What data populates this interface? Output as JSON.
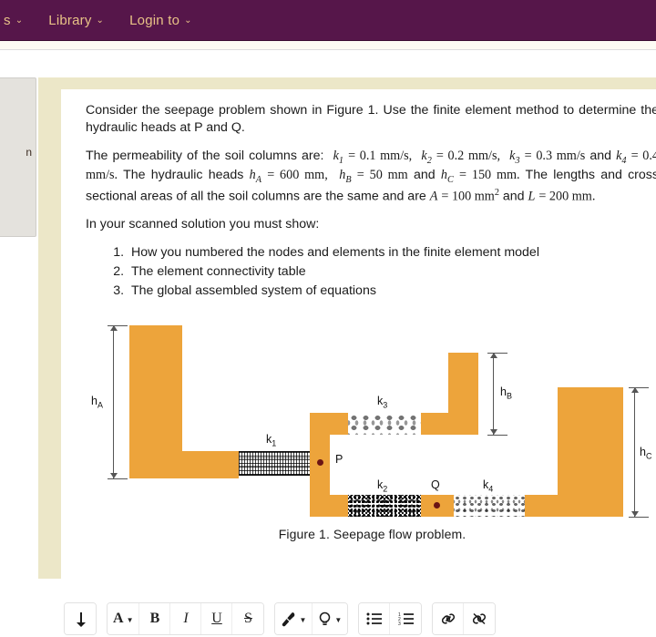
{
  "topnav": {
    "items": [
      {
        "label": "s",
        "caret": "⌄"
      },
      {
        "label": "Library",
        "caret": "⌄"
      },
      {
        "label": "Login to",
        "caret": "⌄"
      }
    ],
    "bg_color": "#56164a",
    "text_color": "#e8c287"
  },
  "left_panel": {
    "text": "n"
  },
  "question": {
    "para1": "Consider the seepage problem shown in Figure 1. Use the finite element method to determine the hydraulic heads at P and Q.",
    "para2_prefix": "The permeability of the soil columns are:",
    "k1": "k",
    "k1_sub": "1",
    "k1_val": "= 0.1 mm/s,",
    "k2": "k",
    "k2_sub": "2",
    "k2_val": "= 0.2 mm/s,",
    "k3": "k",
    "k3_sub": "3",
    "k3_val": "= 0.3 mm/s",
    "and1": "and",
    "k4": "k",
    "k4_sub": "4",
    "k4_val": "= 0.4 mm/s.",
    "heads_prefix": "The hydraulic heads",
    "hA": "h",
    "hA_sub": "A",
    "hA_val": "= 600 mm,",
    "hB": "h",
    "hB_sub": "B",
    "hB_val": "= 50 mm",
    "and2": "and",
    "hC": "h",
    "hC_sub": "C",
    "hC_val": "= 150 mm.",
    "tail": "The lengths and cross sectional areas of all the soil columns are the same and are",
    "A": "A",
    "A_val": "= 100 mm",
    "A_sup": "2",
    "and3": "and",
    "L": "L",
    "L_val": "= 200 mm.",
    "para3": "In your scanned solution you must show:",
    "list": [
      "How you numbered the nodes and elements in the finite element model",
      "The element connectivity table",
      "The global assembled system of equations"
    ]
  },
  "figure": {
    "caption": "Figure 1. Seepage flow problem.",
    "labels": {
      "hA": "h",
      "hA_sub": "A",
      "hB": "h",
      "hB_sub": "B",
      "hC": "h",
      "hC_sub": "C",
      "k1": "k",
      "k1_sub": "1",
      "k2": "k",
      "k2_sub": "2",
      "k3": "k",
      "k3_sub": "3",
      "k4": "k",
      "k4_sub": "4",
      "P": "P",
      "Q": "Q"
    },
    "colors": {
      "soil_body": "#eda43b",
      "node_dot": "#6b1414",
      "dimension_line": "#555555"
    }
  },
  "toolbar": {
    "groups": [
      {
        "buttons": [
          {
            "name": "undo-redo-button",
            "glyph": "⤴",
            "dropdown": false
          }
        ]
      },
      {
        "buttons": [
          {
            "name": "font-color-button",
            "glyph": "A",
            "dropdown": true
          },
          {
            "name": "bold-button",
            "glyph": "B",
            "dropdown": false
          },
          {
            "name": "italic-button",
            "glyph": "I",
            "dropdown": false
          },
          {
            "name": "underline-button",
            "glyph": "U",
            "dropdown": false
          },
          {
            "name": "strikethrough-button",
            "glyph": "S",
            "dropdown": false
          }
        ]
      },
      {
        "buttons": [
          {
            "name": "brush-button",
            "glyph": "brush-icon",
            "dropdown": true
          },
          {
            "name": "highlight-button",
            "glyph": "bulb-icon",
            "dropdown": true
          }
        ]
      },
      {
        "buttons": [
          {
            "name": "bullet-list-button",
            "glyph": "bullet-list-icon",
            "dropdown": false
          },
          {
            "name": "numbered-list-button",
            "glyph": "numbered-list-icon",
            "dropdown": false
          }
        ]
      },
      {
        "buttons": [
          {
            "name": "insert-link-button",
            "glyph": "link-icon",
            "dropdown": false
          },
          {
            "name": "remove-link-button",
            "glyph": "unlink-icon",
            "dropdown": false
          }
        ]
      }
    ]
  }
}
